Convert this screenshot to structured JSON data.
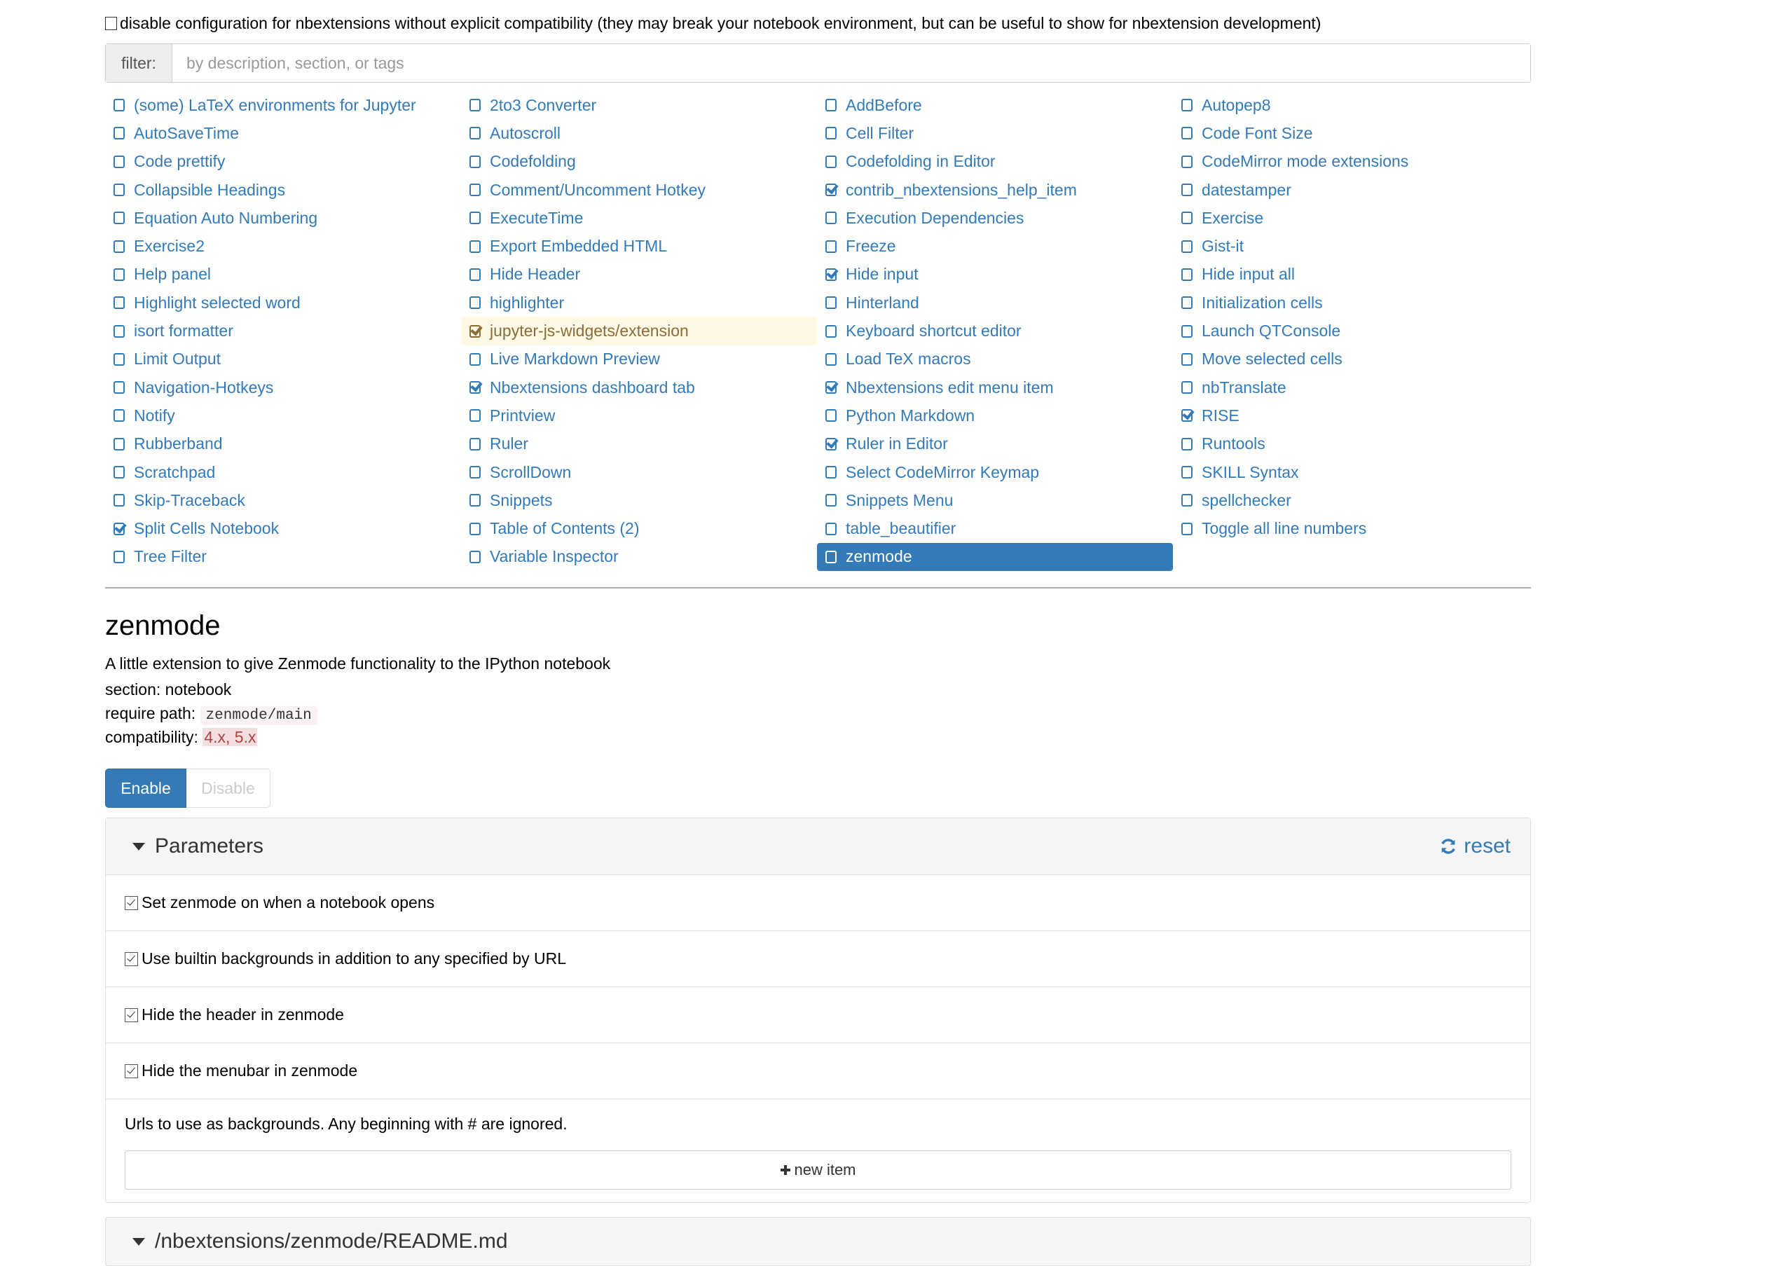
{
  "compat_toggle": {
    "checked": false,
    "label": "disable configuration for nbextensions without explicit compatibility (they may break your notebook environment, but can be useful to show for nbextension development)"
  },
  "filter": {
    "label": "filter:",
    "value": "",
    "placeholder": "by description, section, or tags"
  },
  "extensions": [
    {
      "label": "(some) LaTeX environments for Jupyter",
      "enabled": false
    },
    {
      "label": "AutoSaveTime",
      "enabled": false
    },
    {
      "label": "Code prettify",
      "enabled": false
    },
    {
      "label": "Collapsible Headings",
      "enabled": false
    },
    {
      "label": "Equation Auto Numbering",
      "enabled": false
    },
    {
      "label": "Exercise2",
      "enabled": false
    },
    {
      "label": "Help panel",
      "enabled": false
    },
    {
      "label": "Highlight selected word",
      "enabled": false
    },
    {
      "label": "isort formatter",
      "enabled": false
    },
    {
      "label": "Limit Output",
      "enabled": false
    },
    {
      "label": "Navigation-Hotkeys",
      "enabled": false
    },
    {
      "label": "Notify",
      "enabled": false
    },
    {
      "label": "Rubberband",
      "enabled": false
    },
    {
      "label": "Scratchpad",
      "enabled": false
    },
    {
      "label": "Skip-Traceback",
      "enabled": false
    },
    {
      "label": "Split Cells Notebook",
      "enabled": true
    },
    {
      "label": "Tree Filter",
      "enabled": false
    },
    {
      "label": "2to3 Converter",
      "enabled": false
    },
    {
      "label": "Autoscroll",
      "enabled": false
    },
    {
      "label": "Codefolding",
      "enabled": false
    },
    {
      "label": "Comment/Uncomment Hotkey",
      "enabled": false
    },
    {
      "label": "ExecuteTime",
      "enabled": false
    },
    {
      "label": "Export Embedded HTML",
      "enabled": false
    },
    {
      "label": "Hide Header",
      "enabled": false
    },
    {
      "label": "highlighter",
      "enabled": false
    },
    {
      "label": "jupyter-js-widgets/extension",
      "enabled": true,
      "state": "warning"
    },
    {
      "label": "Live Markdown Preview",
      "enabled": false
    },
    {
      "label": "Nbextensions dashboard tab",
      "enabled": true
    },
    {
      "label": "Printview",
      "enabled": false
    },
    {
      "label": "Ruler",
      "enabled": false
    },
    {
      "label": "ScrollDown",
      "enabled": false
    },
    {
      "label": "Snippets",
      "enabled": false
    },
    {
      "label": "Table of Contents (2)",
      "enabled": false
    },
    {
      "label": "Variable Inspector",
      "enabled": false
    },
    {
      "label": "AddBefore",
      "enabled": false
    },
    {
      "label": "Cell Filter",
      "enabled": false
    },
    {
      "label": "Codefolding in Editor",
      "enabled": false
    },
    {
      "label": "contrib_nbextensions_help_item",
      "enabled": true
    },
    {
      "label": "Execution Dependencies",
      "enabled": false
    },
    {
      "label": "Freeze",
      "enabled": false
    },
    {
      "label": "Hide input",
      "enabled": true
    },
    {
      "label": "Hinterland",
      "enabled": false
    },
    {
      "label": "Keyboard shortcut editor",
      "enabled": false
    },
    {
      "label": "Load TeX macros",
      "enabled": false
    },
    {
      "label": "Nbextensions edit menu item",
      "enabled": true
    },
    {
      "label": "Python Markdown",
      "enabled": false
    },
    {
      "label": "Ruler in Editor",
      "enabled": true
    },
    {
      "label": "Select CodeMirror Keymap",
      "enabled": false
    },
    {
      "label": "Snippets Menu",
      "enabled": false
    },
    {
      "label": "table_beautifier",
      "enabled": false
    },
    {
      "label": "zenmode",
      "enabled": false,
      "state": "selected"
    },
    {
      "label": "Autopep8",
      "enabled": false
    },
    {
      "label": "Code Font Size",
      "enabled": false
    },
    {
      "label": "CodeMirror mode extensions",
      "enabled": false
    },
    {
      "label": "datestamper",
      "enabled": false
    },
    {
      "label": "Exercise",
      "enabled": false
    },
    {
      "label": "Gist-it",
      "enabled": false
    },
    {
      "label": "Hide input all",
      "enabled": false
    },
    {
      "label": "Initialization cells",
      "enabled": false
    },
    {
      "label": "Launch QTConsole",
      "enabled": false
    },
    {
      "label": "Move selected cells",
      "enabled": false
    },
    {
      "label": "nbTranslate",
      "enabled": false
    },
    {
      "label": "RISE",
      "enabled": true
    },
    {
      "label": "Runtools",
      "enabled": false
    },
    {
      "label": "SKILL Syntax",
      "enabled": false
    },
    {
      "label": "spellchecker",
      "enabled": false
    },
    {
      "label": "Toggle all line numbers",
      "enabled": false
    }
  ],
  "detail": {
    "title": "zenmode",
    "description": "A little extension to give Zenmode functionality to the IPython notebook",
    "section_label": "section:",
    "section_value": "notebook",
    "require_label": "require path:",
    "require_value": "zenmode/main",
    "compat_label": "compatibility:",
    "compat_value": "4.x, 5.x",
    "enable_label": "Enable",
    "disable_label": "Disable"
  },
  "parameters": {
    "title": "Parameters",
    "reset_label": "reset",
    "items": [
      {
        "label": "Set zenmode on when a notebook opens",
        "checked": true
      },
      {
        "label": "Use builtin backgrounds in addition to any specified by URL",
        "checked": true
      },
      {
        "label": "Hide the header in zenmode",
        "checked": true
      },
      {
        "label": "Hide the menubar in zenmode",
        "checked": true
      }
    ],
    "url_label": "Urls to use as backgrounds. Any beginning with # are ignored.",
    "new_item_label": "new item"
  },
  "readme": {
    "title": "/nbextensions/zenmode/README.md"
  },
  "colors": {
    "link": "#337ab7",
    "selected_bg": "#337ab7",
    "warning_bg": "#fcf8e3",
    "warning_text": "#8a6d3b",
    "compat_bg": "#f2dede",
    "compat_text": "#a94442"
  }
}
